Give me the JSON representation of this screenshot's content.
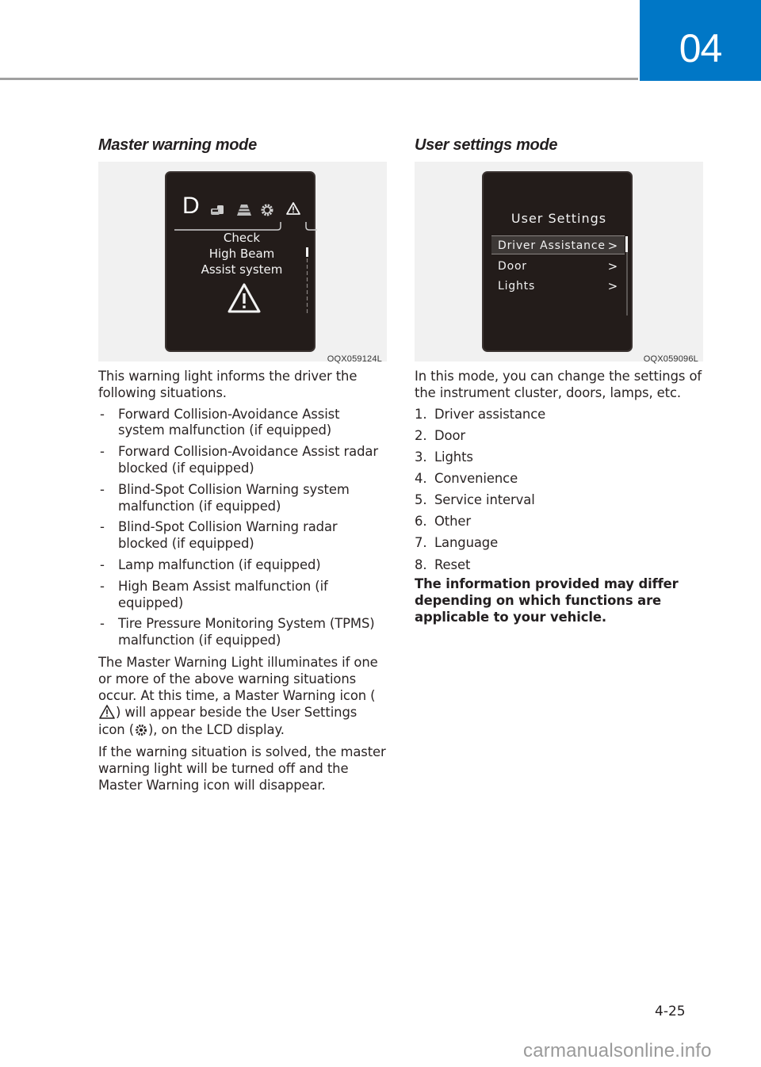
{
  "header": {
    "chapter_number": "04",
    "accent_color": "#0077c6"
  },
  "left": {
    "title": "Master warning mode",
    "figure": {
      "caption": "OQX059124L",
      "lcd": {
        "gear": "D",
        "tab_icons": [
          "vehicle-distance-icon",
          "lane-icon",
          "gear-icon",
          "warning-icon"
        ],
        "message_lines": [
          "Check",
          "High Beam",
          "Assist system"
        ]
      }
    },
    "intro": "This warning light informs the driver the following situations.",
    "bullets": [
      "Forward Collision-Avoidance Assist system malfunction (if equipped)",
      "Forward Collision-Avoidance Assist radar blocked (if equipped)",
      "Blind-Spot Collision Warning system malfunction (if equipped)",
      "Blind-Spot Collision Warning radar blocked (if equipped)",
      "Lamp malfunction (if equipped)",
      "High Beam Assist malfunction (if equipped)",
      "Tire Pressure Monitoring System (TPMS) malfunction (if equipped)"
    ],
    "bullet_marker": "-",
    "para1_a": "The Master Warning Light illuminates if one or more of the above warning situations occur. At this time, a Master Warning icon (",
    "para1_b": ") will appear beside the User Settings icon (",
    "para1_c": "), on the LCD display.",
    "para2": "If the warning situation is solved, the master warning light will be turned off and the Master Warning icon will disappear."
  },
  "right": {
    "title": "User settings mode",
    "figure": {
      "caption": "OQX059096L",
      "lcd": {
        "title": "User Settings",
        "items": [
          {
            "label": "Driver Assistance",
            "chevron": ">"
          },
          {
            "label": "Door",
            "chevron": ">"
          },
          {
            "label": "Lights",
            "chevron": ">"
          }
        ]
      }
    },
    "intro": "In this mode, you can change the settings of the instrument cluster, doors, lamps, etc.",
    "list": [
      {
        "num": "1.",
        "label": "Driver assistance"
      },
      {
        "num": "2.",
        "label": "Door"
      },
      {
        "num": "3.",
        "label": "Lights"
      },
      {
        "num": "4.",
        "label": "Convenience"
      },
      {
        "num": "5.",
        "label": "Service interval"
      },
      {
        "num": "6.",
        "label": "Other"
      },
      {
        "num": "7.",
        "label": "Language"
      },
      {
        "num": "8.",
        "label": "Reset"
      }
    ],
    "note": "The information provided may differ depending on which functions are applicable to your vehicle."
  },
  "footer": {
    "page_number": "4-25",
    "watermark": "carmanualsonline.info"
  }
}
